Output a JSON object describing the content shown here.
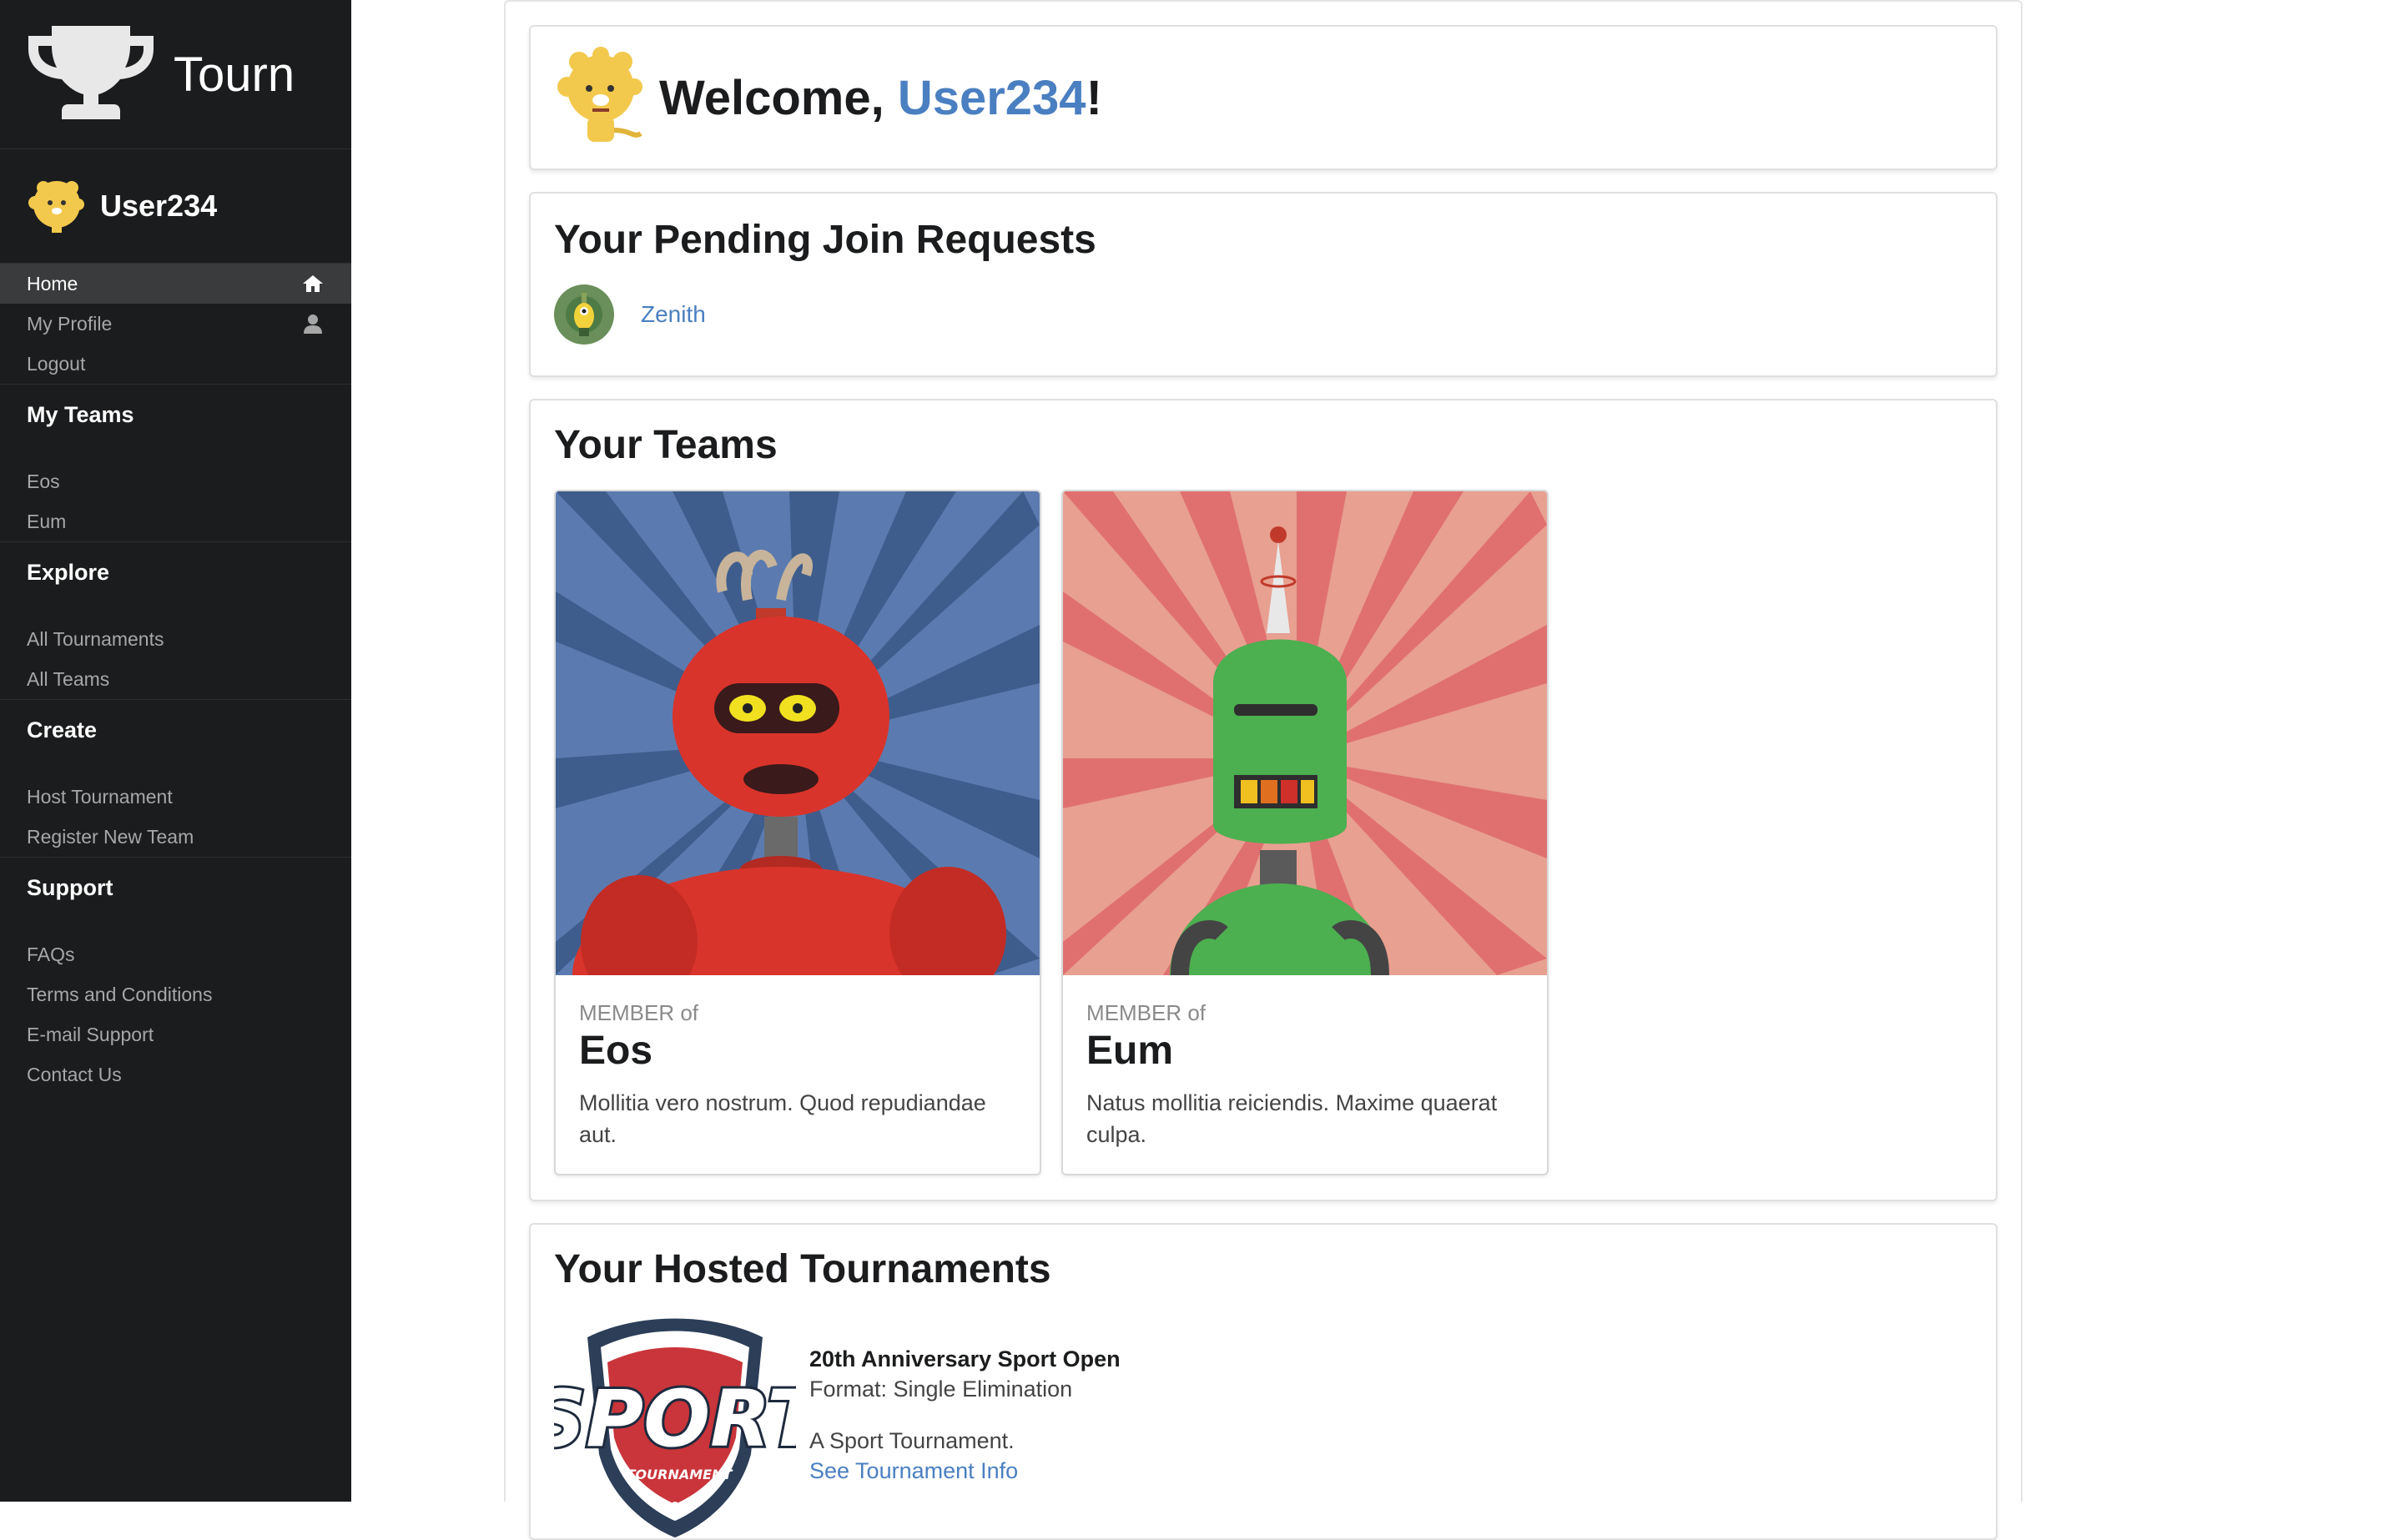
{
  "brand": {
    "name": "Tourn",
    "icon": "trophy-icon"
  },
  "user": {
    "name": "User234"
  },
  "menu": {
    "home": "Home",
    "profile": "My Profile",
    "logout": "Logout"
  },
  "sections": {
    "my_teams": {
      "title": "My Teams",
      "items": [
        "Eos",
        "Eum"
      ]
    },
    "explore": {
      "title": "Explore",
      "items": [
        "All Tournaments",
        "All Teams"
      ]
    },
    "create": {
      "title": "Create",
      "items": [
        "Host Tournament",
        "Register New Team"
      ]
    },
    "support": {
      "title": "Support",
      "items": [
        "FAQs",
        "Terms and Conditions",
        "E-mail Support",
        "Contact Us"
      ]
    }
  },
  "welcome": {
    "prefix": "Welcome, ",
    "name": "User234",
    "suffix": "!"
  },
  "pending": {
    "title": "Your Pending Join Requests",
    "requests": [
      {
        "name": "Zenith"
      }
    ]
  },
  "teams": {
    "title": "Your Teams",
    "cards": [
      {
        "meta": "MEMBER of",
        "name": "Eos",
        "description": "Mollitia vero nostrum. Quod repudiandae aut."
      },
      {
        "meta": "MEMBER of",
        "name": "Eum",
        "description": "Natus mollitia reiciendis. Maxime quaerat culpa."
      }
    ]
  },
  "hosted": {
    "title": "Your Hosted Tournaments",
    "tournaments": [
      {
        "name": "20th Anniversary Sport Open",
        "format": "Format: Single Elimination",
        "description": "A Sport Tournament.",
        "link": "See Tournament Info",
        "logo_text": "SPORT",
        "logo_sub": "TOURNAMENT"
      }
    ]
  },
  "colors": {
    "sidebar": "#1b1c1d",
    "link": "#4a7fc1",
    "active": "#3a3b3c"
  }
}
